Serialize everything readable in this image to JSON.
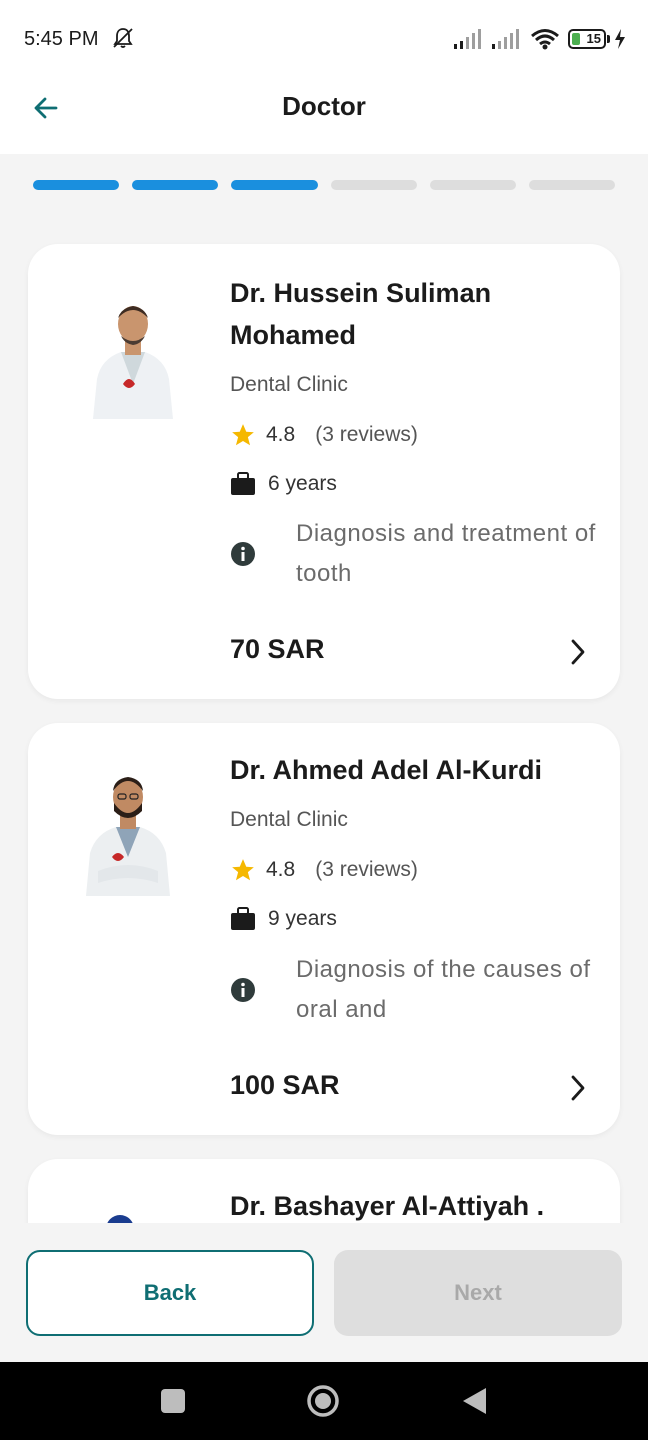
{
  "status_bar": {
    "time": "5:45 PM",
    "battery_level": "15",
    "icons": [
      "bell-off-icon",
      "signal-icon",
      "signal-icon",
      "wifi-icon",
      "battery-icon",
      "charging-icon"
    ]
  },
  "app_bar": {
    "title": "Doctor",
    "back_icon": "arrow-left-icon"
  },
  "progress": {
    "total_steps": 6,
    "completed_steps": 3,
    "active_color": "#1a8fde",
    "inactive_color": "#dddddd"
  },
  "doctors": [
    {
      "name": "Dr. Hussein Suliman Mohamed",
      "clinic": "Dental Clinic",
      "rating": "4.8",
      "reviews": "(3 reviews)",
      "experience": "6 years",
      "description": "Diagnosis and treatment of tooth",
      "price": "70 SAR"
    },
    {
      "name": "Dr. Ahmed Adel Al-Kurdi",
      "clinic": "Dental Clinic",
      "rating": "4.8",
      "reviews": "(3 reviews)",
      "experience": "9 years",
      "description": "Diagnosis of the causes of oral and",
      "price": "100 SAR"
    },
    {
      "name": "Dr. Bashayer Al-Attiyah ."
    }
  ],
  "footer": {
    "back_label": "Back",
    "next_label": "Next",
    "accent_color": "#0f6e73"
  }
}
